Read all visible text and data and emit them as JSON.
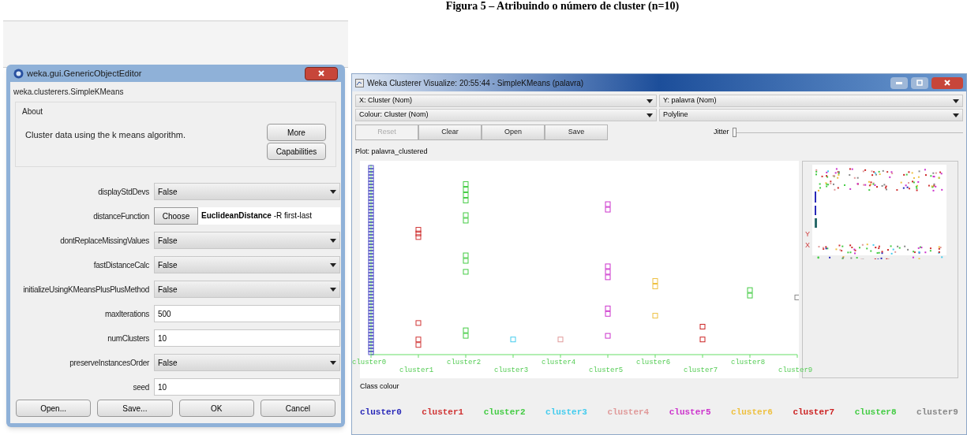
{
  "caption": "Figura 5 – Atribuindo o número de cluster (n=10)",
  "editor": {
    "title": "weka.gui.GenericObjectEditor",
    "class_name": "weka.clusterers.SimpleKMeans",
    "about": {
      "heading": "About",
      "text": "Cluster data using the k means algorithm.",
      "buttons": [
        "More",
        "Capabilities"
      ]
    },
    "properties": [
      {
        "kind": "dropdown",
        "label": "displayStdDevs",
        "value": "False"
      },
      {
        "kind": "chooser",
        "label": "distanceFunction",
        "button": "Choose",
        "value": "**EuclideanDistance** -R first-last"
      },
      {
        "kind": "dropdown",
        "label": "dontReplaceMissingValues",
        "value": "False"
      },
      {
        "kind": "dropdown",
        "label": "fastDistanceCalc",
        "value": "False"
      },
      {
        "kind": "dropdown",
        "label": "initializeUsingKMeansPlusPlusMethod",
        "value": "False"
      },
      {
        "kind": "text",
        "label": "maxIterations",
        "value": "500"
      },
      {
        "kind": "text",
        "label": "numClusters",
        "value": "10"
      },
      {
        "kind": "dropdown",
        "label": "preserveInstancesOrder",
        "value": "False"
      },
      {
        "kind": "text",
        "label": "seed",
        "value": "10"
      }
    ],
    "buttons": [
      "Open...",
      "Save...",
      "OK",
      "Cancel"
    ]
  },
  "visualizer": {
    "title": "Weka Clusterer Visualize: 20:55:44 - SimpleKMeans (palavra)",
    "selectors": [
      "X: Cluster (Nom)",
      "Y: palavra (Nom)",
      "Colour: Cluster (Nom)",
      "Polyline"
    ],
    "buttons": [
      {
        "label": "Reset",
        "disabled": true
      },
      {
        "label": "Clear",
        "disabled": false
      },
      {
        "label": "Open",
        "disabled": false
      },
      {
        "label": "Save",
        "disabled": false
      }
    ],
    "jitter": {
      "label": "Jitter",
      "level": 0
    },
    "plot_title": "Plot: palavra_clustered",
    "overview_axes": [
      "Y",
      "X"
    ],
    "x_labels": [
      "cluster0",
      "cluster1",
      "cluster2",
      "cluster3",
      "cluster4",
      "cluster5",
      "cluster6",
      "cluster7",
      "cluster8",
      "cluster9"
    ],
    "class_colour": {
      "heading": "Class colour",
      "classes": [
        {
          "label": "cluster0",
          "color": "#2828b8"
        },
        {
          "label": "cluster1",
          "color": "#d03434"
        },
        {
          "label": "cluster2",
          "color": "#44cc44"
        },
        {
          "label": "cluster3",
          "color": "#44ccee"
        },
        {
          "label": "cluster4",
          "color": "#e09a9a"
        },
        {
          "label": "cluster5",
          "color": "#cc33cc"
        },
        {
          "label": "cluster6",
          "color": "#eec040"
        },
        {
          "label": "cluster7",
          "color": "#cc2222"
        },
        {
          "label": "cluster8",
          "color": "#44cc44"
        },
        {
          "label": "cluster9",
          "color": "#888888"
        }
      ]
    }
  }
}
